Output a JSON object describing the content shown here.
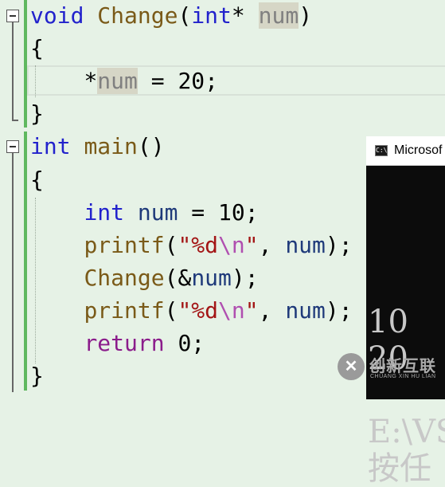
{
  "editor": {
    "lines": [
      {
        "indent": "",
        "tokens": [
          {
            "t": "void",
            "c": "kw"
          },
          {
            "t": " "
          },
          {
            "t": "Change",
            "c": "fn"
          },
          {
            "t": "("
          },
          {
            "t": "int",
            "c": "kw"
          },
          {
            "t": "* "
          },
          {
            "t": "num",
            "c": "param hl"
          },
          {
            "t": ")"
          }
        ]
      },
      {
        "indent": "",
        "tokens": [
          {
            "t": "{"
          }
        ]
      },
      {
        "indent": "    ",
        "tokens": [
          {
            "t": "*"
          },
          {
            "t": "num",
            "c": "param hl"
          },
          {
            "t": " = 20;"
          }
        ]
      },
      {
        "indent": "",
        "tokens": [
          {
            "t": "}"
          }
        ]
      },
      {
        "indent": "",
        "tokens": [
          {
            "t": "int",
            "c": "kw"
          },
          {
            "t": " "
          },
          {
            "t": "main",
            "c": "fn"
          },
          {
            "t": "()"
          }
        ]
      },
      {
        "indent": "",
        "tokens": [
          {
            "t": "{"
          }
        ]
      },
      {
        "indent": "    ",
        "tokens": [
          {
            "t": "int",
            "c": "kw"
          },
          {
            "t": " "
          },
          {
            "t": "num",
            "c": "var"
          },
          {
            "t": " = 10;"
          }
        ]
      },
      {
        "indent": "    ",
        "tokens": [
          {
            "t": "printf",
            "c": "fn"
          },
          {
            "t": "("
          },
          {
            "t": "\"%d",
            "c": "str"
          },
          {
            "t": "\\n",
            "c": "esc"
          },
          {
            "t": "\"",
            "c": "str"
          },
          {
            "t": ", "
          },
          {
            "t": "num",
            "c": "var"
          },
          {
            "t": ");"
          }
        ]
      },
      {
        "indent": "    ",
        "tokens": [
          {
            "t": "Change",
            "c": "fn"
          },
          {
            "t": "(&"
          },
          {
            "t": "num",
            "c": "var"
          },
          {
            "t": ");"
          }
        ]
      },
      {
        "indent": "    ",
        "tokens": [
          {
            "t": "printf",
            "c": "fn"
          },
          {
            "t": "("
          },
          {
            "t": "\"%d",
            "c": "str"
          },
          {
            "t": "\\n",
            "c": "esc"
          },
          {
            "t": "\"",
            "c": "str"
          },
          {
            "t": ", "
          },
          {
            "t": "num",
            "c": "var"
          },
          {
            "t": ");"
          }
        ]
      },
      {
        "indent": "    ",
        "tokens": [
          {
            "t": "return",
            "c": "kw2"
          },
          {
            "t": " 0;"
          }
        ]
      },
      {
        "indent": "",
        "tokens": [
          {
            "t": "}"
          }
        ]
      }
    ]
  },
  "console": {
    "title": "Microsof",
    "icon": "console-icon",
    "output": [
      "10",
      "20",
      "",
      "E:\\VS",
      "按任"
    ]
  },
  "watermark": {
    "name": "创新互联",
    "sub": "CHUANG XIN HU LIAN",
    "logo": "✕"
  }
}
